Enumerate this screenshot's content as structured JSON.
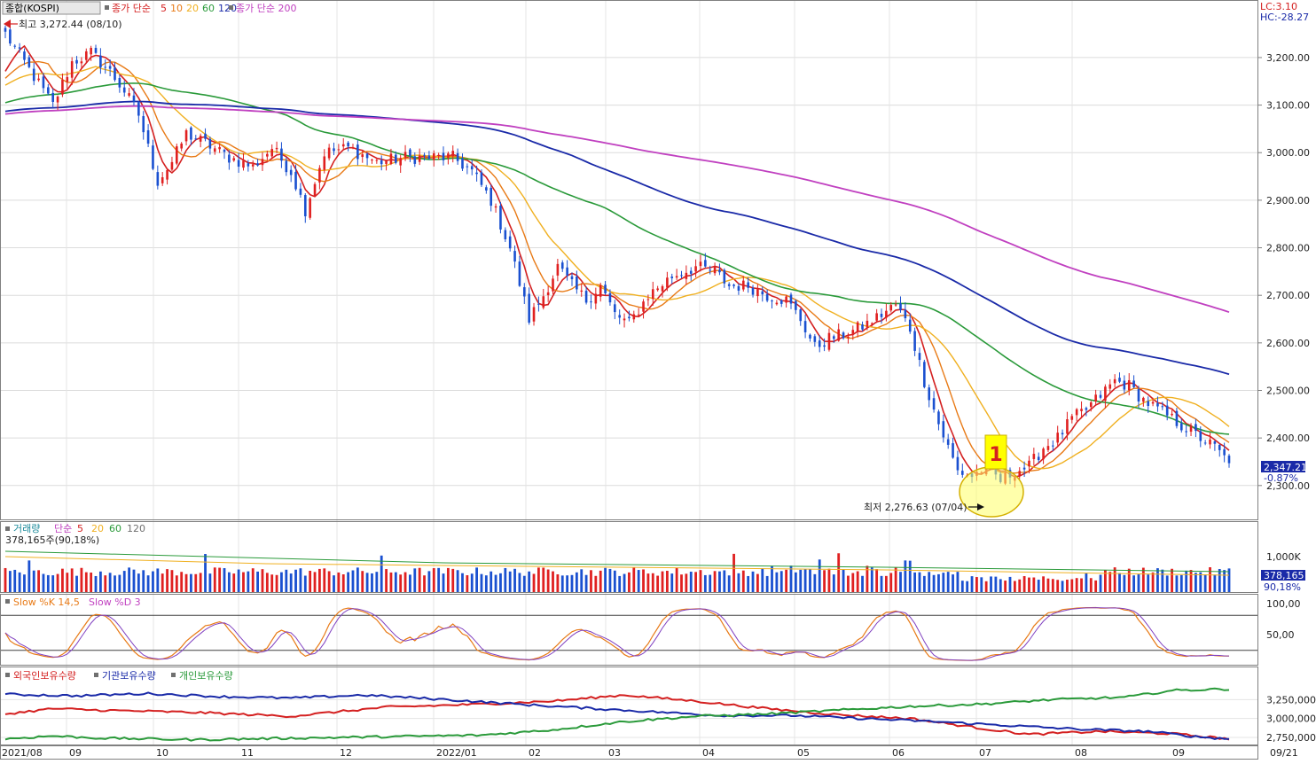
{
  "chart_data": [
    {
      "type": "candlestick",
      "index_label": "종합(KOSPI)",
      "ma_label": "종가 단순",
      "ma_periods": [
        "5",
        "10",
        "20",
        "60",
        "120"
      ],
      "ma_long_label": "종가 단순 200",
      "ma_colors": {
        "5": "#d42020",
        "10": "#e87a16",
        "20": "#f0b020",
        "60": "#2a9a3a",
        "120": "#1a2aa8",
        "200": "#c040c0"
      },
      "ylim": [
        2240,
        3280
      ],
      "y_ticks": [
        "3,200.00",
        "3,100.00",
        "3,000.00",
        "2,900.00",
        "2,800.00",
        "2,700.00",
        "2,600.00",
        "2,500.00",
        "2,400.00",
        "2,300.00"
      ],
      "y_tick_values": [
        3200,
        3100,
        3000,
        2900,
        2800,
        2700,
        2600,
        2500,
        2400,
        2300
      ],
      "lc_label": "LC:3.10",
      "hc_label": "HC:-28.27",
      "last_price": "2,347.21",
      "last_change": "-0.87%",
      "high_label": "최고 3,272.44 (08/10)",
      "low_label": "최저 2,276.63 (07/04)",
      "marker_label": "1",
      "x_labels": [
        "2021/08",
        "09",
        "10",
        "11",
        "12",
        "2022/01",
        "02",
        "03",
        "04",
        "05",
        "06",
        "07",
        "08",
        "09",
        "09/21"
      ],
      "close_keypoints": [
        [
          0,
          3250
        ],
        [
          6,
          3160
        ],
        [
          10,
          3100
        ],
        [
          14,
          3190
        ],
        [
          18,
          3210
        ],
        [
          22,
          3170
        ],
        [
          25,
          3130
        ],
        [
          28,
          3080
        ],
        [
          32,
          2940
        ],
        [
          35,
          2980
        ],
        [
          38,
          3040
        ],
        [
          42,
          3020
        ],
        [
          47,
          2990
        ],
        [
          52,
          2970
        ],
        [
          56,
          3010
        ],
        [
          60,
          2960
        ],
        [
          63,
          2880
        ],
        [
          67,
          3000
        ],
        [
          72,
          3010
        ],
        [
          78,
          2980
        ],
        [
          84,
          2990
        ],
        [
          90,
          2990
        ],
        [
          94,
          2990
        ],
        [
          98,
          2960
        ],
        [
          102,
          2900
        ],
        [
          106,
          2800
        ],
        [
          110,
          2650
        ],
        [
          113,
          2700
        ],
        [
          116,
          2760
        ],
        [
          119,
          2720
        ],
        [
          122,
          2690
        ],
        [
          125,
          2720
        ],
        [
          128,
          2660
        ],
        [
          131,
          2640
        ],
        [
          135,
          2700
        ],
        [
          140,
          2740
        ],
        [
          145,
          2760
        ],
        [
          149,
          2750
        ],
        [
          152,
          2720
        ],
        [
          156,
          2720
        ],
        [
          160,
          2700
        ],
        [
          164,
          2690
        ],
        [
          167,
          2650
        ],
        [
          170,
          2590
        ],
        [
          173,
          2610
        ],
        [
          177,
          2620
        ],
        [
          181,
          2640
        ],
        [
          184,
          2660
        ],
        [
          187,
          2680
        ],
        [
          190,
          2630
        ],
        [
          193,
          2520
        ],
        [
          196,
          2430
        ],
        [
          200,
          2330
        ],
        [
          203,
          2320
        ],
        [
          206,
          2340
        ],
        [
          209,
          2310
        ],
        [
          212,
          2330
        ],
        [
          215,
          2340
        ],
        [
          218,
          2380
        ],
        [
          221,
          2400
        ],
        [
          224,
          2440
        ],
        [
          227,
          2460
        ],
        [
          230,
          2490
        ],
        [
          233,
          2520
        ],
        [
          236,
          2510
        ],
        [
          239,
          2480
        ],
        [
          242,
          2460
        ],
        [
          245,
          2440
        ],
        [
          248,
          2420
        ],
        [
          251,
          2400
        ],
        [
          254,
          2380
        ],
        [
          257,
          2347
        ]
      ]
    },
    {
      "type": "bar",
      "title": "거래량",
      "ma_label": "단순",
      "ma_periods": [
        "5",
        "20",
        "60",
        "120"
      ],
      "value_label": "378,165주(90,18%)",
      "y_tick": "1,000K",
      "last_value": "378,165",
      "last_pct": "90,18%"
    },
    {
      "type": "line",
      "series": [
        {
          "name": "Slow %K 14,5"
        },
        {
          "name": "Slow %D 3"
        }
      ],
      "ylim": [
        0,
        100
      ],
      "y_ticks": [
        "100,00",
        "50,00"
      ],
      "thresholds": [
        80,
        20
      ]
    },
    {
      "type": "line",
      "series": [
        {
          "name": "외국인보유수량",
          "color": "#d42020",
          "keypoints": [
            [
              0,
              3060
            ],
            [
              10,
              3130
            ],
            [
              20,
              3110
            ],
            [
              40,
              3080
            ],
            [
              60,
              3030
            ],
            [
              80,
              3150
            ],
            [
              100,
              3190
            ],
            [
              115,
              3230
            ],
            [
              130,
              3310
            ],
            [
              145,
              3230
            ],
            [
              160,
              3130
            ],
            [
              175,
              3050
            ],
            [
              190,
              3000
            ],
            [
              205,
              2870
            ],
            [
              215,
              2790
            ],
            [
              230,
              2830
            ],
            [
              245,
              2800
            ],
            [
              257,
              2730
            ]
          ]
        },
        {
          "name": "기관보유수량",
          "color": "#1a2aa8",
          "keypoints": [
            [
              0,
              3320
            ],
            [
              15,
              3300
            ],
            [
              30,
              3330
            ],
            [
              45,
              3290
            ],
            [
              60,
              3270
            ],
            [
              75,
              3310
            ],
            [
              90,
              3260
            ],
            [
              110,
              3180
            ],
            [
              130,
              3110
            ],
            [
              150,
              3040
            ],
            [
              165,
              3040
            ],
            [
              180,
              3000
            ],
            [
              195,
              2960
            ],
            [
              210,
              2910
            ],
            [
              225,
              2860
            ],
            [
              240,
              2830
            ],
            [
              250,
              2760
            ],
            [
              257,
              2730
            ]
          ]
        },
        {
          "name": "개인보유수량",
          "color": "#2a9a3a",
          "keypoints": [
            [
              0,
              2730
            ],
            [
              10,
              2770
            ],
            [
              20,
              2740
            ],
            [
              40,
              2720
            ],
            [
              60,
              2740
            ],
            [
              80,
              2760
            ],
            [
              100,
              2780
            ],
            [
              115,
              2850
            ],
            [
              130,
              2960
            ],
            [
              145,
              3030
            ],
            [
              160,
              3060
            ],
            [
              175,
              3110
            ],
            [
              190,
              3160
            ],
            [
              205,
              3190
            ],
            [
              220,
              3250
            ],
            [
              235,
              3280
            ],
            [
              245,
              3370
            ],
            [
              257,
              3390
            ]
          ]
        }
      ],
      "y_ticks": [
        "3,250,000",
        "3,000,000",
        "2,750,000"
      ],
      "y_tick_values": [
        3250,
        3000,
        2750
      ],
      "ylim": [
        2680,
        3500
      ]
    }
  ]
}
